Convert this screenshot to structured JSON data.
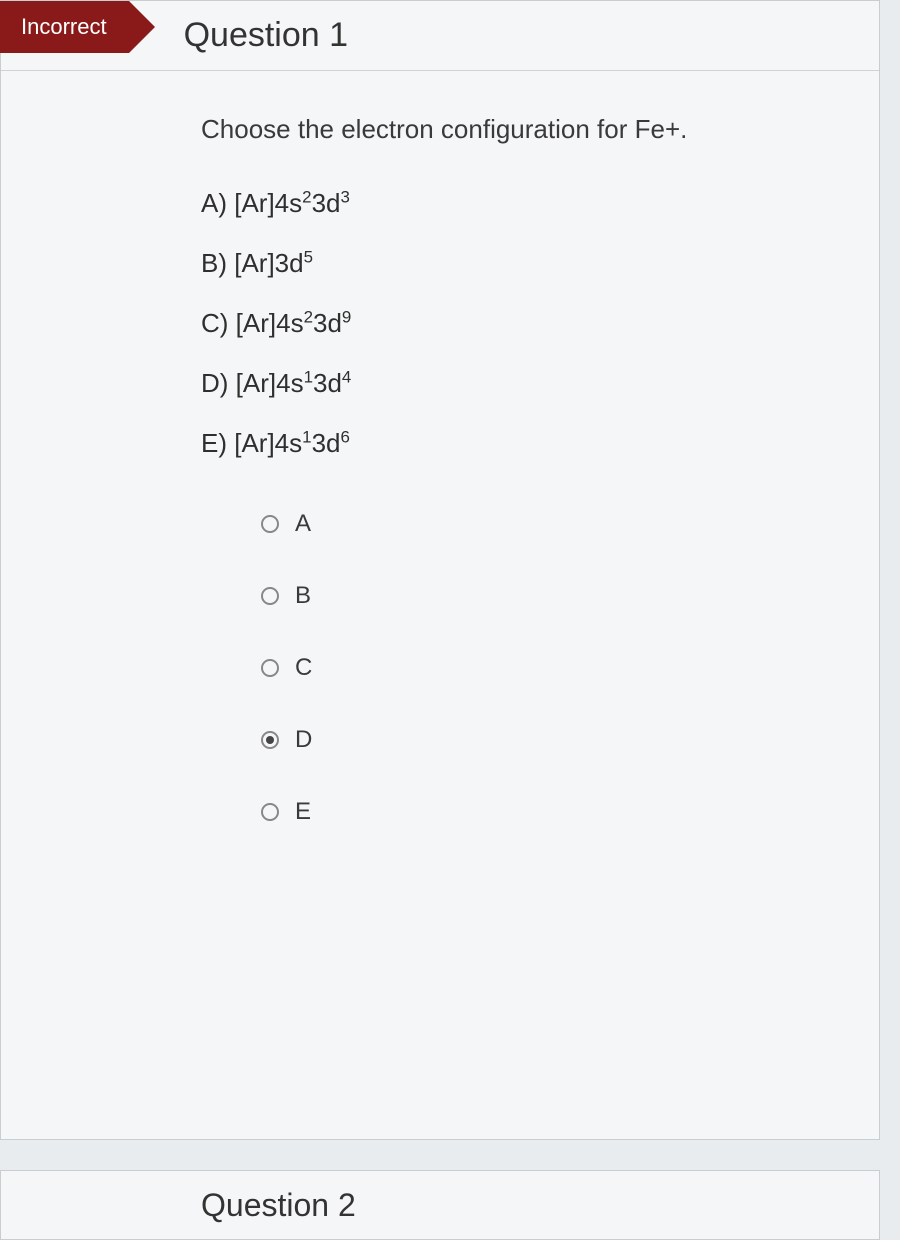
{
  "badge": "Incorrect",
  "question_title": "Question 1",
  "prompt": "Choose the electron configuration for Fe+.",
  "options": [
    {
      "letter": "A",
      "prefix": "[Ar]4s",
      "sup1": "2",
      "mid": "3d",
      "sup2": "3"
    },
    {
      "letter": "B",
      "prefix": "[Ar]3d",
      "sup1": "5",
      "mid": "",
      "sup2": ""
    },
    {
      "letter": "C",
      "prefix": "[Ar]4s",
      "sup1": "2",
      "mid": "3d",
      "sup2": "9"
    },
    {
      "letter": "D",
      "prefix": "[Ar]4s",
      "sup1": "1",
      "mid": "3d",
      "sup2": "4"
    },
    {
      "letter": "E",
      "prefix": "[Ar]4s",
      "sup1": "1",
      "mid": "3d",
      "sup2": "6"
    }
  ],
  "answers": [
    {
      "label": "A",
      "selected": false
    },
    {
      "label": "B",
      "selected": false
    },
    {
      "label": "C",
      "selected": false
    },
    {
      "label": "D",
      "selected": true
    },
    {
      "label": "E",
      "selected": false
    }
  ],
  "next_question_title": "Question 2"
}
